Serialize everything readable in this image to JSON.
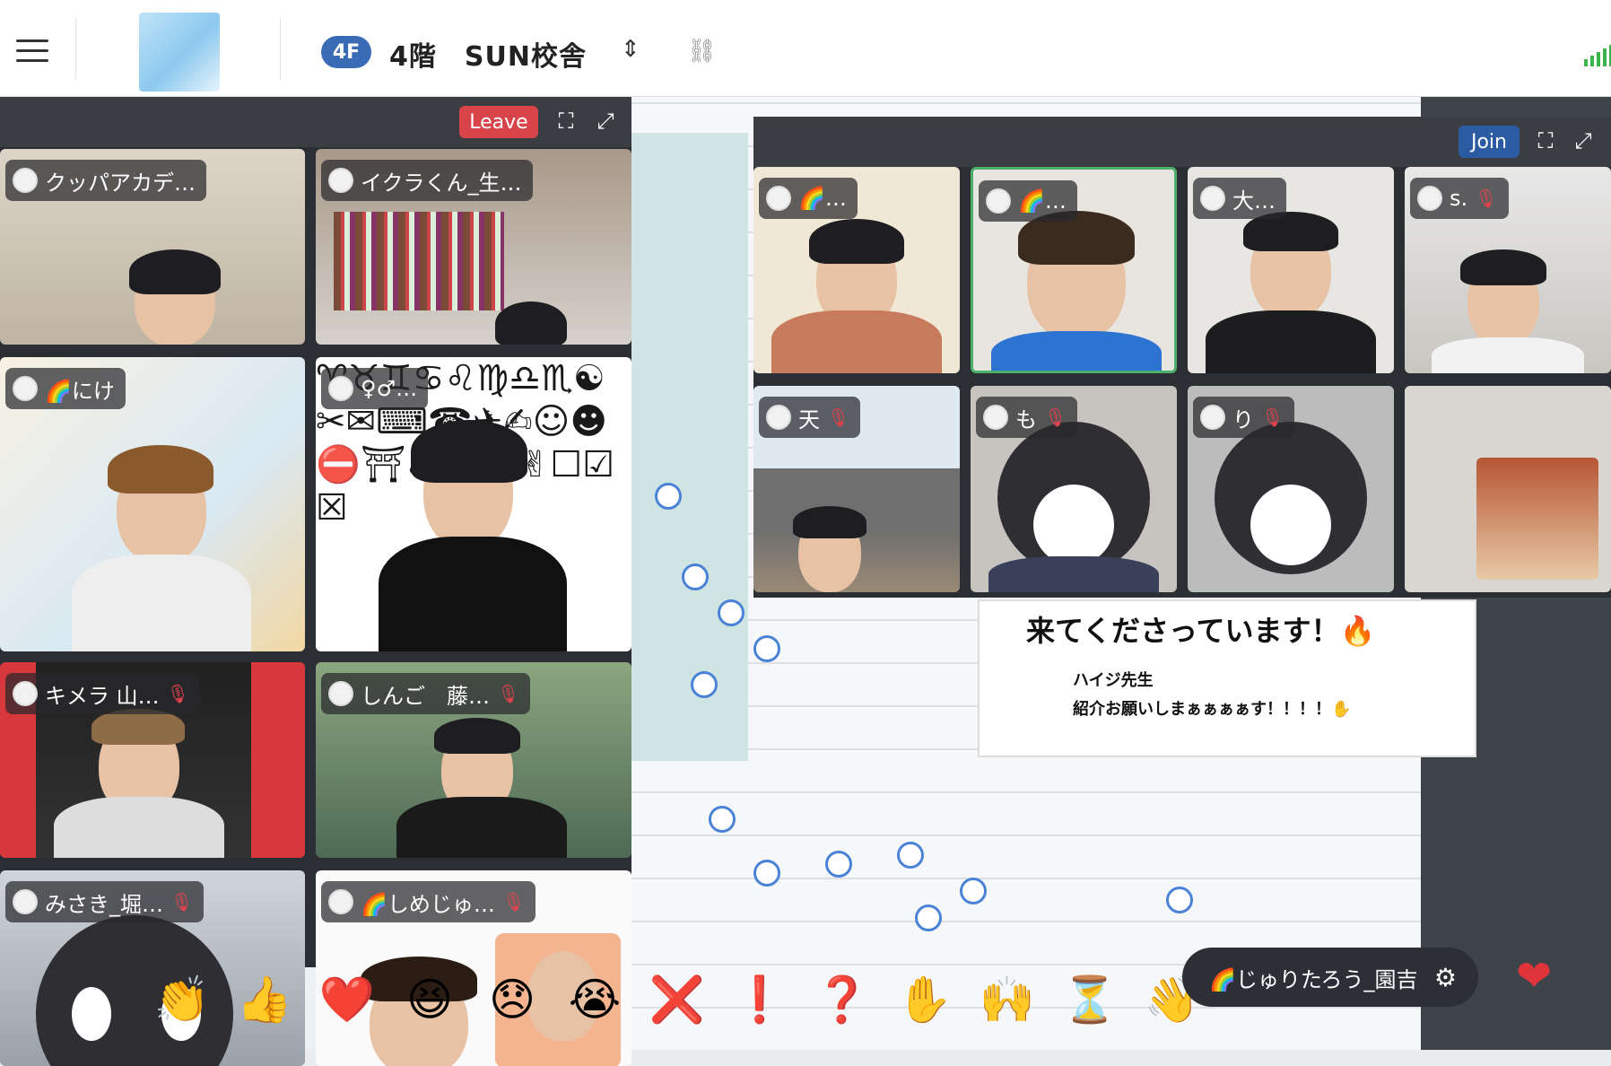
{
  "header": {
    "floor_badge": "4F",
    "floor_name": "4階　SUN校舎",
    "switch_icon": "⇕",
    "link_icon": "⛓"
  },
  "left_panel": {
    "leave_label": "Leave",
    "tiles": [
      {
        "name": "クッパアカデ…",
        "muted": false
      },
      {
        "name": "イクラくん_生…",
        "muted": false
      },
      {
        "name": "🌈にけ",
        "muted": false
      },
      {
        "name": "♀♂…",
        "muted": false
      },
      {
        "name": "キメラ 山…",
        "muted": true
      },
      {
        "name": "しんご　藤…",
        "muted": true
      },
      {
        "name": "みさき_堀…",
        "muted": true
      },
      {
        "name": "🌈しめじゅ…",
        "muted": true
      }
    ]
  },
  "right_panel": {
    "join_label": "Join",
    "tiles": [
      {
        "name": "🌈…",
        "muted": false
      },
      {
        "name": "🌈…",
        "muted": false
      },
      {
        "name": "大…",
        "muted": false
      },
      {
        "name": "s.",
        "muted": true
      },
      {
        "name": "天",
        "muted": true
      },
      {
        "name": "も",
        "muted": true
      },
      {
        "name": "り",
        "muted": true
      }
    ]
  },
  "slide": {
    "title": "来てくださっています！🔥",
    "line1": "ハイジ先生",
    "line2": "紹介お願いしまぁぁぁぁす！！！！✋"
  },
  "reactions": [
    "👏",
    "👍",
    "❤️",
    "😆",
    "😞",
    "😭",
    "❌",
    "❗",
    "❓",
    "✋",
    "🙌",
    "⏳",
    "👋",
    "🎉"
  ],
  "user_pill": {
    "name": "🌈じゅりたろう_園吉",
    "settings_icon": "⚙"
  },
  "heart": "❤"
}
